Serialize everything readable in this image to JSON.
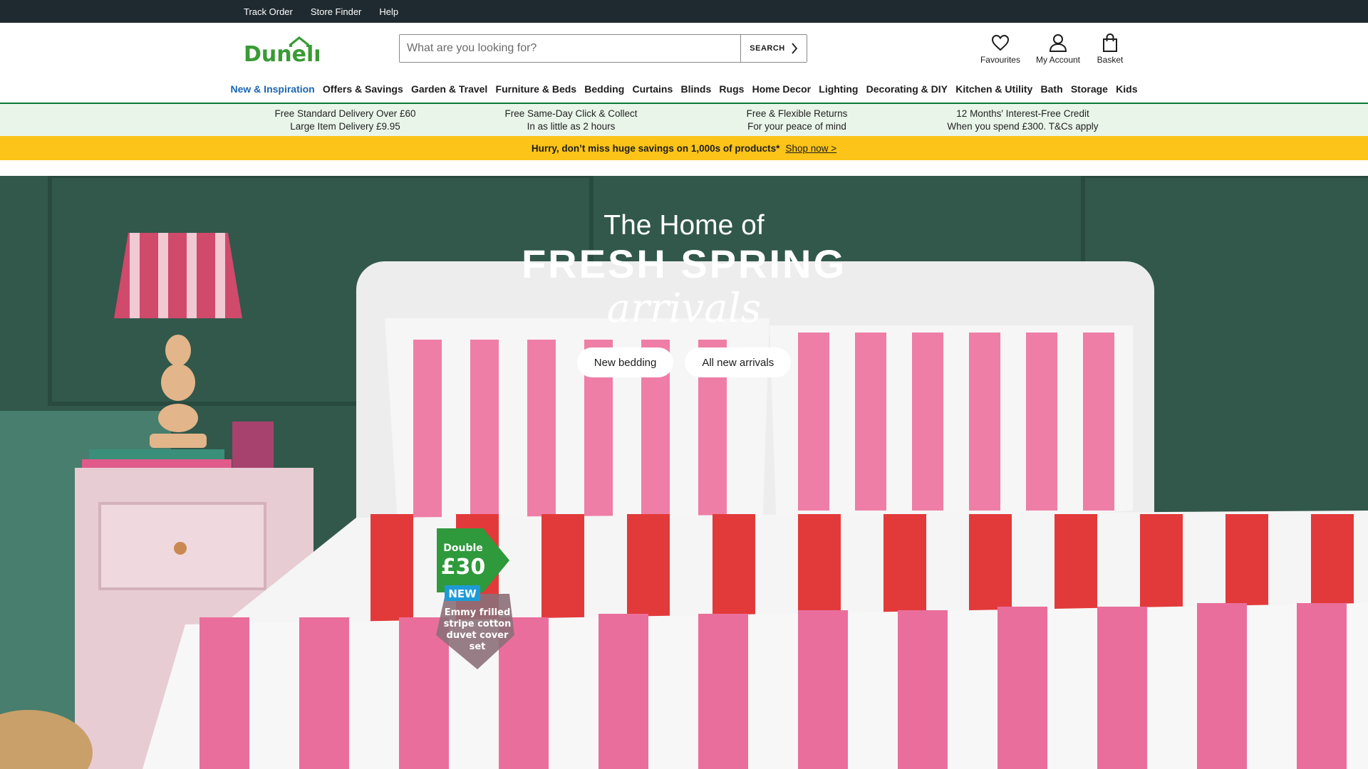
{
  "utility_nav": [
    "Track Order",
    "Store Finder",
    "Help"
  ],
  "brand": {
    "logo_text": "Dunelm",
    "color": "#3a9b35"
  },
  "search": {
    "placeholder": "What are you looking for?",
    "button_label": "SEARCH"
  },
  "header_icons": {
    "favourites": "Favourites",
    "account": "My Account",
    "basket": "Basket"
  },
  "main_nav": [
    "New & Inspiration",
    "Offers & Savings",
    "Garden & Travel",
    "Furniture & Beds",
    "Bedding",
    "Curtains",
    "Blinds",
    "Rugs",
    "Home Decor",
    "Lighting",
    "Decorating & DIY",
    "Kitchen & Utility",
    "Bath",
    "Storage",
    "Kids"
  ],
  "usps": [
    {
      "line1": "Free Standard Delivery Over £60",
      "line2": "Large Item Delivery £9.95"
    },
    {
      "line1": "Free Same-Day Click & Collect",
      "line2": "In as little as 2 hours"
    },
    {
      "line1": "Free & Flexible Returns",
      "line2": "For your peace of mind"
    },
    {
      "line1": "12 Months' Interest-Free Credit",
      "line2": "When you spend £300. T&Cs apply"
    }
  ],
  "promo": {
    "message": "Hurry, don’t miss huge savings on 1,000s of products*",
    "link": "Shop now >"
  },
  "hero": {
    "line1": "The Home of",
    "line2": "FRESH SPRING",
    "line3": "arrivals",
    "cta1": "New bedding",
    "cta2": "All new arrivals",
    "tag": {
      "size": "Double",
      "price": "£30",
      "badge": "NEW",
      "product": [
        "Emmy frilled",
        "stripe cotton",
        "duvet cover",
        "set"
      ]
    }
  },
  "colors": {
    "top_bar": "#1f2a30",
    "nav_active": "#1a66b3",
    "usp_bg": "#eaf5ea",
    "promo_bg": "#fcc419",
    "tag_green": "#2e9a3c",
    "tag_blue": "#1e9bd7"
  }
}
